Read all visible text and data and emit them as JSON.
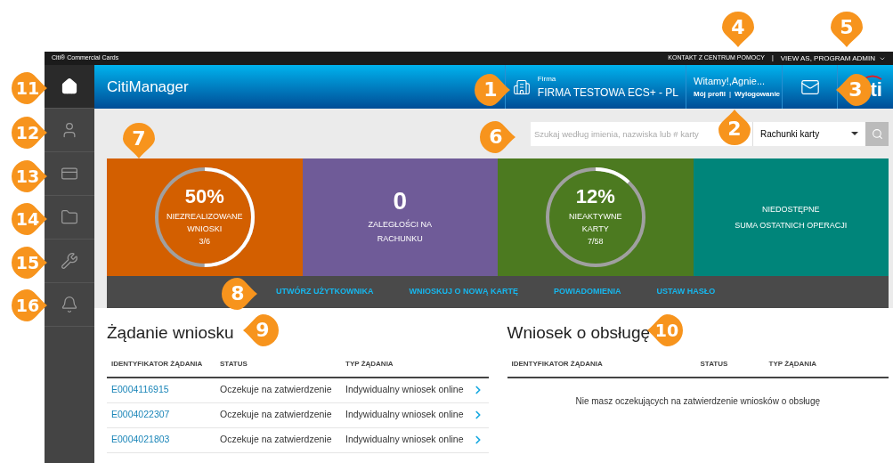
{
  "top_bar": {
    "brand": "Citi® Commercial Cards",
    "help_link": "KONTAKT Z CENTRUM POMOCY",
    "separator": "|",
    "view_as": "VIEW AS, PROGRAM ADMIN"
  },
  "header": {
    "title": "CitiManager",
    "company_label": "Firma",
    "company_name": "FIRMA TESTOWA ECS+ - PL",
    "welcome": "Witamy!,Agnie...",
    "profile_link": "Mój profil",
    "links_separator": "|",
    "logout_link": "Wylogowanie",
    "logo_text": "ti"
  },
  "sidebar": {
    "items": [
      {
        "selected": true
      },
      {
        "selected": false
      },
      {
        "selected": false
      },
      {
        "selected": false
      },
      {
        "selected": false
      },
      {
        "selected": false
      }
    ]
  },
  "search": {
    "placeholder": "Szukaj według imienia, nazwiska lub # karty",
    "scope": "Rachunki karty"
  },
  "tiles": [
    {
      "kind": "ring",
      "color": "#d35f00",
      "value": "50%",
      "label": "NIEZREALIZOWANE WNIOSKI",
      "detail": "3/6",
      "level": 0.5
    },
    {
      "kind": "count",
      "color": "#6f5b98",
      "value": "0",
      "label": "ZALEGŁOŚCI NA RACHUNKU"
    },
    {
      "kind": "ring",
      "color": "#4c7a20",
      "value": "12%",
      "label": "NIEAKTYWNE KARTY",
      "detail": "7/58",
      "level": 0.12
    },
    {
      "kind": "text",
      "color": "#00857a",
      "label": "NIEDOSTĘPNE",
      "detail": "SUMA OSTATNICH OPERACJI"
    }
  ],
  "quick_links": [
    "UTWÓRZ UŻYTKOWNIKA",
    "WNIOSKUJ O NOWĄ KARTĘ",
    "POWIADOMIENIA",
    "USTAW HASŁO"
  ],
  "requests": {
    "title": "Żądanie wniosku",
    "columns": [
      "IDENTYFIKATOR ŻĄDANIA",
      "STATUS",
      "TYP ŻĄDANIA"
    ],
    "rows": [
      {
        "id": "E0004116915",
        "status": "Oczekuje na zatwierdzenie",
        "type": "Indywidualny wniosek online"
      },
      {
        "id": "E0004022307",
        "status": "Oczekuje na zatwierdzenie",
        "type": "Indywidualny wniosek online"
      },
      {
        "id": "E0004021803",
        "status": "Oczekuje na zatwierdzenie",
        "type": "Indywidualny wniosek online"
      }
    ]
  },
  "service": {
    "title": "Wniosek o obsługę",
    "columns": [
      "IDENTYFIKATOR ŻĄDANIA",
      "STATUS",
      "TYP ŻĄDANIA"
    ],
    "empty_message": "Nie masz oczekujących na zatwierdzenie wniosków o obsługę"
  },
  "callouts": [
    {
      "number": "4",
      "kind": "down"
    },
    {
      "number": "5",
      "kind": "down"
    },
    {
      "number": "11",
      "kind": "right"
    },
    {
      "number": "1",
      "kind": "right"
    },
    {
      "number": "3",
      "kind": "left"
    },
    {
      "number": "12",
      "kind": "right"
    },
    {
      "number": "7",
      "kind": "down"
    },
    {
      "number": "6",
      "kind": "right"
    },
    {
      "number": "2",
      "kind": "up"
    },
    {
      "number": "13",
      "kind": "right"
    },
    {
      "number": "14",
      "kind": "right"
    },
    {
      "number": "15",
      "kind": "right"
    },
    {
      "number": "8",
      "kind": "right"
    },
    {
      "number": "16",
      "kind": "right"
    },
    {
      "number": "9",
      "kind": "left"
    },
    {
      "number": "10",
      "kind": "left"
    }
  ]
}
